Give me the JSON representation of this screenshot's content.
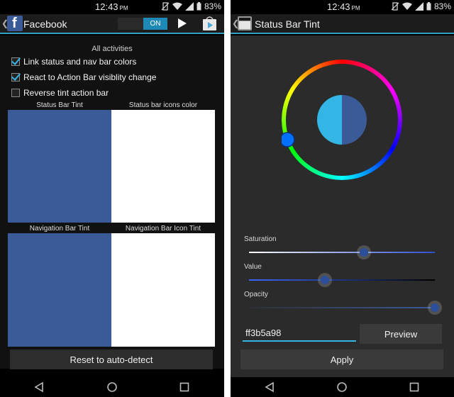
{
  "status_bar": {
    "time": "12:43",
    "ampm": "PM",
    "battery": "83%"
  },
  "left": {
    "app_title": "Facebook",
    "toggle_label": "ON",
    "section_title": "All activities",
    "options": [
      {
        "label": "Link status and nav bar colors",
        "checked": true
      },
      {
        "label": "React to Action Bar visiblity change",
        "checked": true
      },
      {
        "label": "Reverse tint action bar",
        "checked": false
      }
    ],
    "swatches": {
      "status_bar_tint": {
        "label": "Status Bar Tint",
        "color": "#3b5a98"
      },
      "status_bar_icons_color": {
        "label": "Status bar icons color",
        "color": "#ffffff"
      },
      "navigation_bar_tint": {
        "label": "Navigation Bar Tint",
        "color": "#3b5a98"
      },
      "navigation_bar_icon_tint": {
        "label": "Navigation Bar Icon Tint",
        "color": "#ffffff"
      }
    },
    "reset_button": "Reset to auto-detect"
  },
  "right": {
    "app_title": "Status Bar Tint",
    "color_wheel": {
      "old_color": "#33b5e5",
      "new_color": "#3b5a98",
      "handle_color": "#0070ff"
    },
    "sliders": [
      {
        "label": "Saturation",
        "value": 0.62
      },
      {
        "label": "Value",
        "value": 0.41
      },
      {
        "label": "Opacity",
        "value": 1.0
      }
    ],
    "hex_value": "ff3b5a98",
    "preview_button": "Preview",
    "apply_button": "Apply"
  },
  "colors": {
    "accent": "#33b5e5",
    "brand": "#3b5a98"
  }
}
